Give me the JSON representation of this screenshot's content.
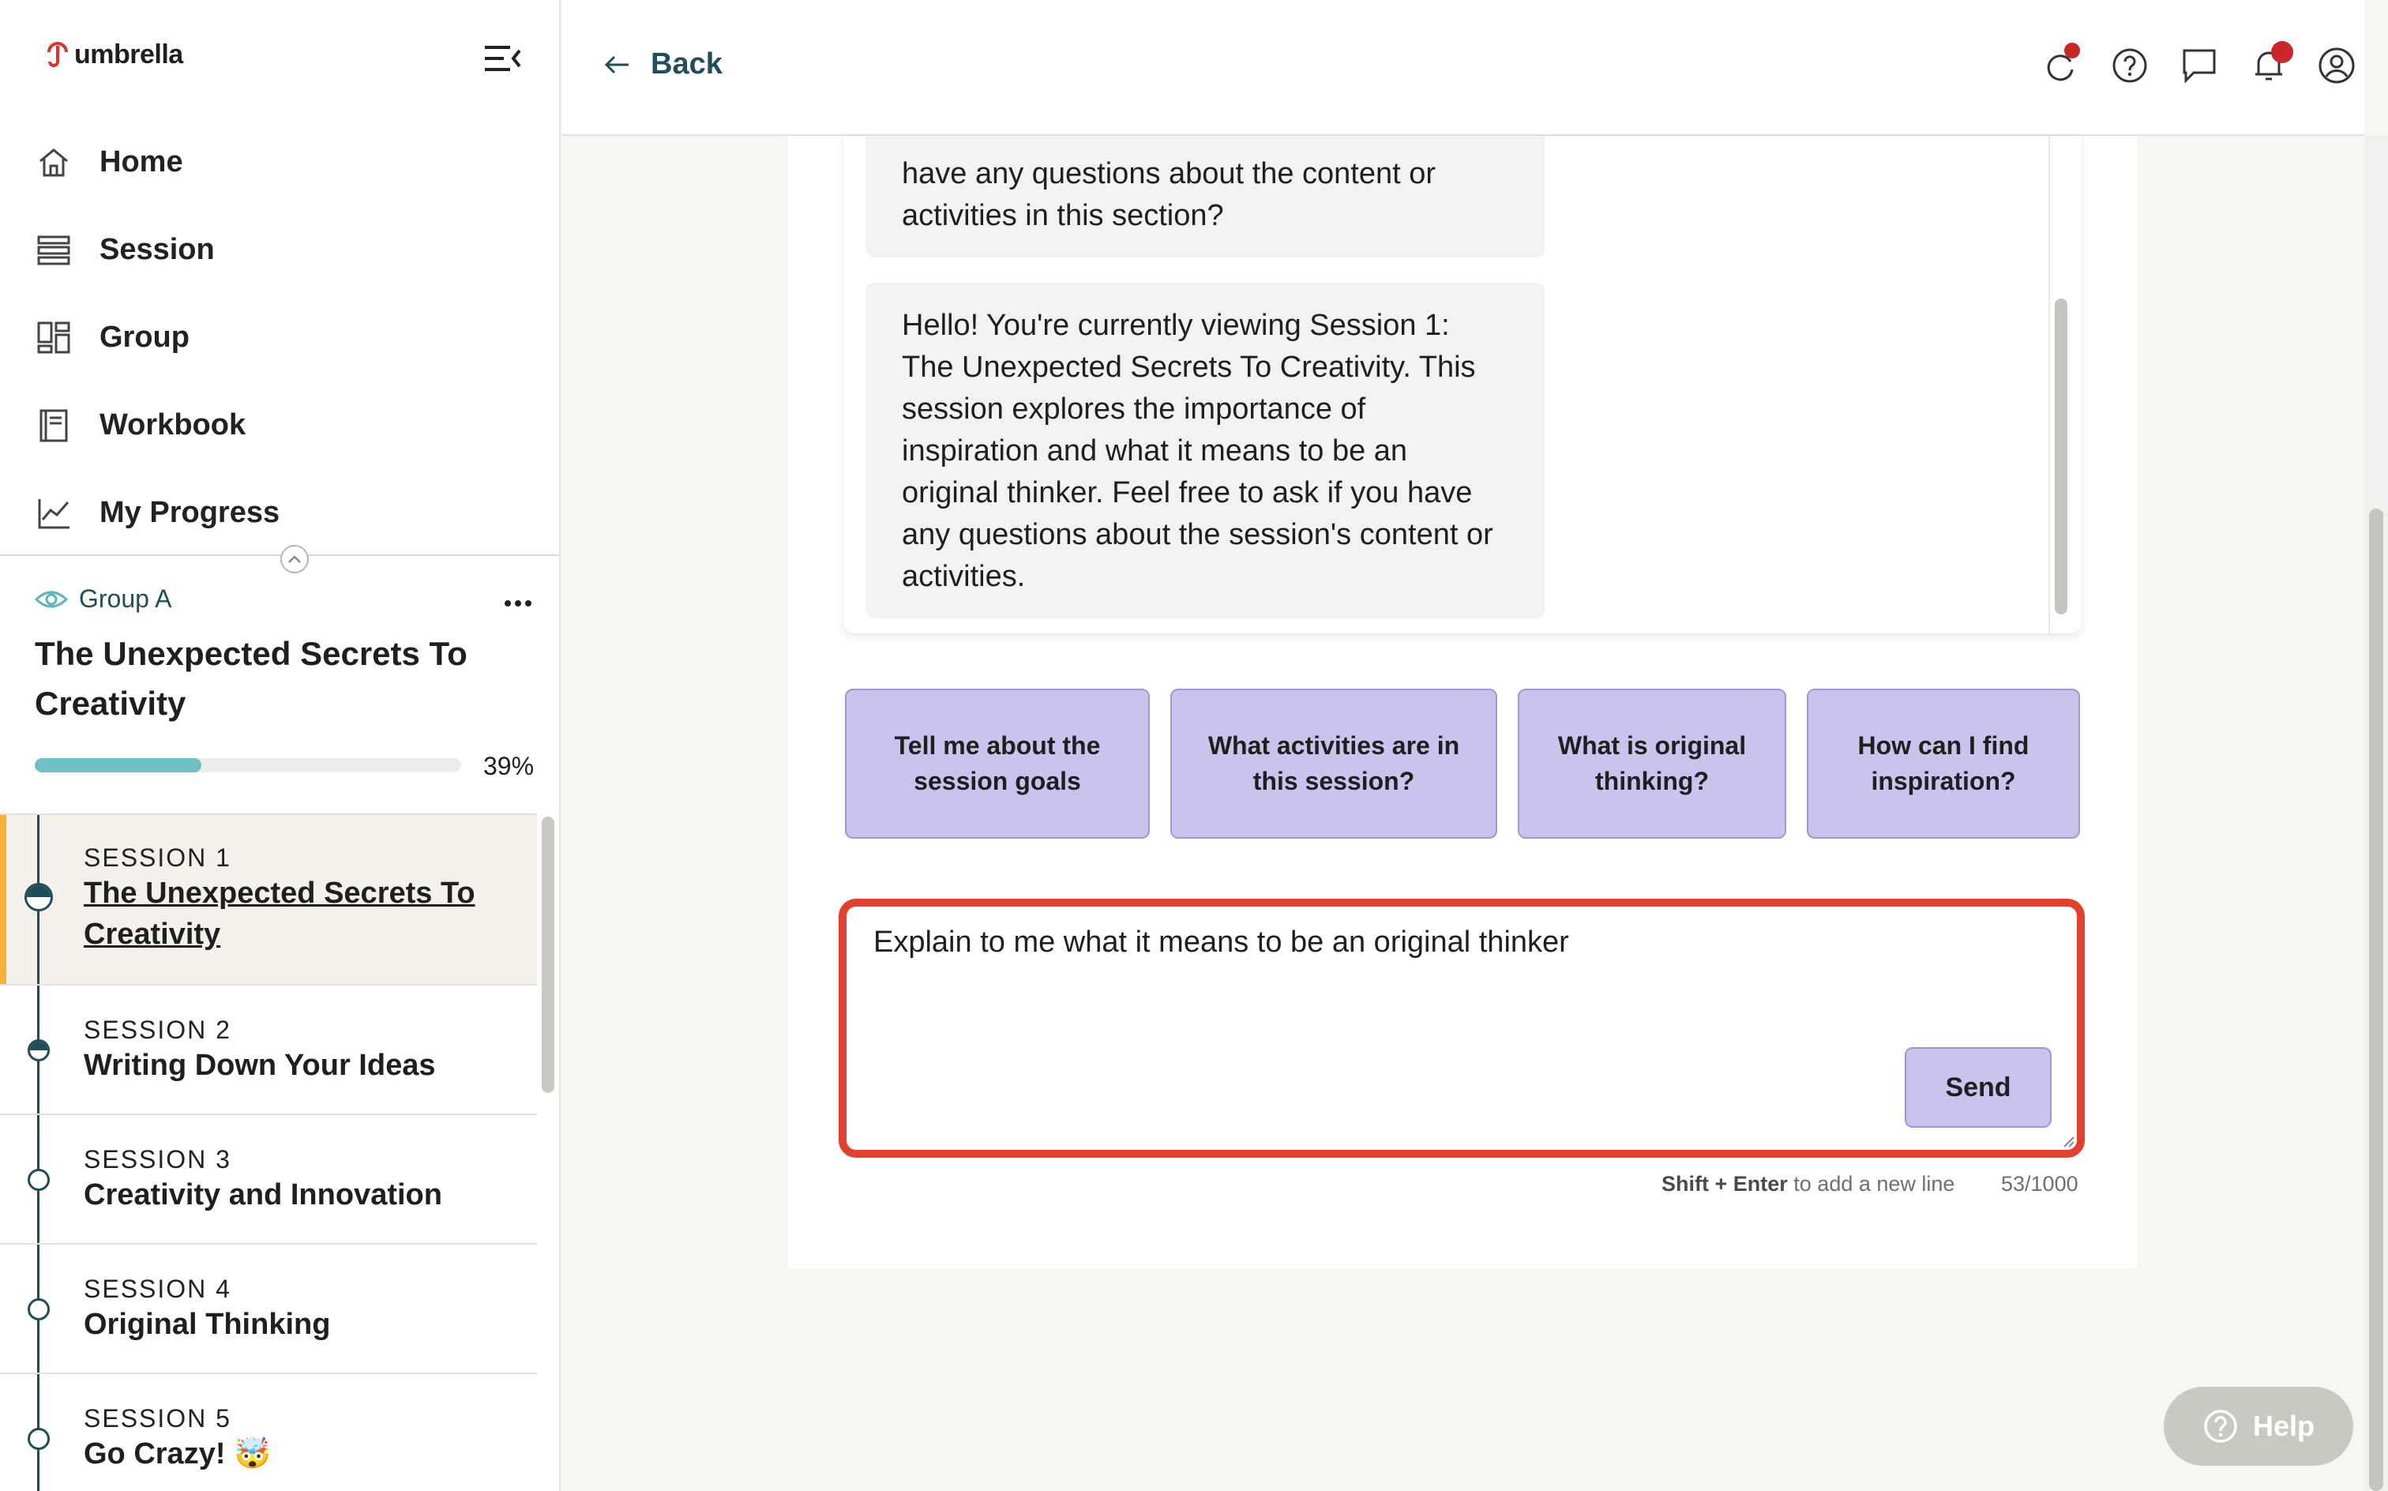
{
  "app": {
    "logo_text": "umbrella"
  },
  "nav": [
    {
      "label": "Home",
      "icon": "home-icon"
    },
    {
      "label": "Session",
      "icon": "list-icon"
    },
    {
      "label": "Group",
      "icon": "group-icon"
    },
    {
      "label": "Workbook",
      "icon": "book-icon"
    },
    {
      "label": "My Progress",
      "icon": "chart-icon"
    }
  ],
  "course": {
    "group_label": "Group A",
    "title": "The Unexpected Secrets To Creativity",
    "progress_text": "39%",
    "progress": 0.39
  },
  "sessions": [
    {
      "number": "SESSION 1",
      "title": "The Unexpected Secrets To Creativity"
    },
    {
      "number": "SESSION 2",
      "title": "Writing Down Your Ideas"
    },
    {
      "number": "SESSION 3",
      "title": "Creativity and Innovation"
    },
    {
      "number": "SESSION 4",
      "title": "Original Thinking"
    },
    {
      "number": "SESSION 5",
      "title": "Go Crazy! 🤯"
    }
  ],
  "topbar": {
    "back_label": "Back"
  },
  "chat": {
    "messages": [
      "have any questions about the content or activities in this section?",
      "Hello! You're currently viewing Session 1: The Unexpected Secrets To Creativity. This session explores the importance of inspiration and what it means to be an original thinker. Feel free to ask if you have any questions about the session's content or activities."
    ],
    "suggestions": [
      "Tell me about the session goals",
      "What activities are in this session?",
      "What is original thinking?",
      "How can I find inspiration?"
    ],
    "input_value": "Explain to me what it means to be an original thinker",
    "send_label": "Send",
    "hint_key": "Shift + Enter",
    "hint_text": " to add a new line",
    "counter": "53/1000"
  },
  "help": {
    "label": "Help"
  },
  "colors": {
    "accent": "#1f4e5a",
    "suggestion": "#c9c4ee",
    "highlight": "#e2402f",
    "badge": "#c8272b"
  }
}
